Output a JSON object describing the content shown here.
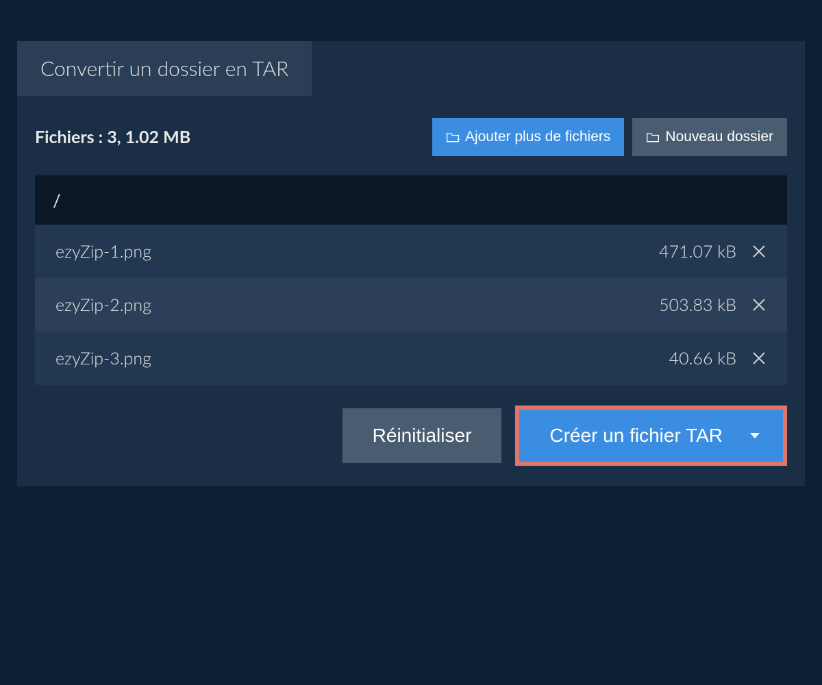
{
  "tab": {
    "title": "Convertir un dossier en TAR"
  },
  "summary": {
    "label": "Fichiers : 3, 1.02 MB"
  },
  "toolbar": {
    "add_files": "Ajouter plus de fichiers",
    "new_folder": "Nouveau dossier"
  },
  "path": {
    "current": "/"
  },
  "files": [
    {
      "name": "ezyZip-1.png",
      "size": "471.07 kB"
    },
    {
      "name": "ezyZip-2.png",
      "size": "503.83 kB"
    },
    {
      "name": "ezyZip-3.png",
      "size": "40.66 kB"
    }
  ],
  "footer": {
    "reset": "Réinitialiser",
    "create": "Créer un fichier TAR"
  }
}
